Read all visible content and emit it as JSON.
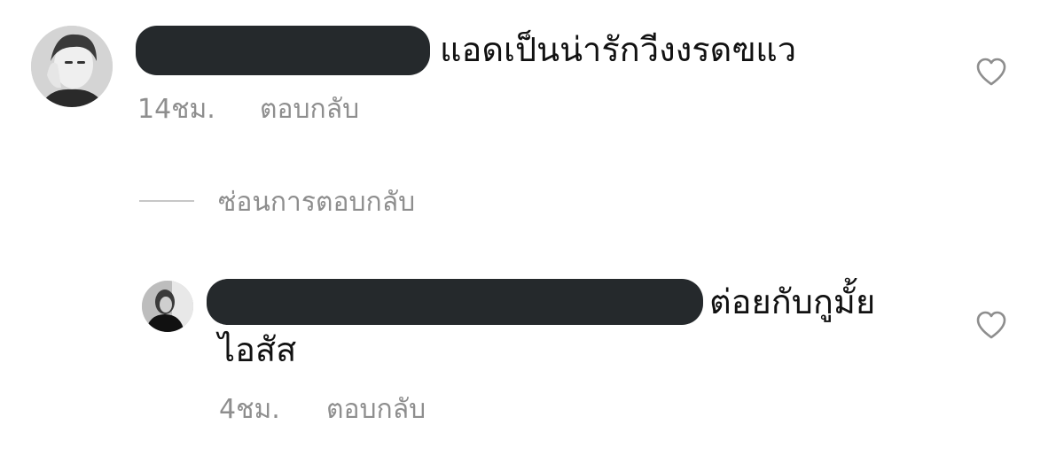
{
  "comments": [
    {
      "username": "",
      "text": "แอดเป็นน่ารักวีงงรดฃแว",
      "time": "14ชม.",
      "reply_label": "ตอบกลับ",
      "like_icon": "heart-outline-icon"
    },
    {
      "username": "",
      "text_line1": "ต่อยกับกูมั้ย",
      "text_line2": "ไอสัส",
      "time": "4ชม.",
      "reply_label": "ตอบกลับ",
      "like_icon": "heart-outline-icon"
    }
  ],
  "hide_replies_label": "ซ่อนการตอบกลับ",
  "colors": {
    "text": "#111111",
    "meta": "#8e8e8e",
    "redaction": "#25292c",
    "divider": "#c7c7c7"
  }
}
